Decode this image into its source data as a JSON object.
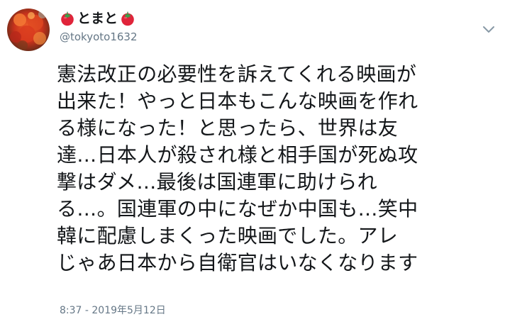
{
  "tweet": {
    "display_name": "とまと",
    "handle": "@tokyoto1632",
    "name_emoji_icon": "tomato-icon",
    "menu_icon": "chevron-down-icon",
    "text_lines": [
      "憲法改正の必要性を訴えてくれる映画が",
      "出来た！やっと日本もこんな映画を作れ",
      "る様になった！と思ったら、世界は友",
      "達…日本人が殺され様と相手国が死ぬ攻",
      "撃はダメ…最後は国連軍に助けられ",
      "る…。国連軍の中になぜか中国も…笑中",
      "韓に配慮しまくった映画でした。アレ",
      "じゃあ日本から自衛官はいなくなります"
    ],
    "timestamp": "8:37 - 2019年5月12日"
  },
  "colors": {
    "text": "#14171a",
    "secondary": "#657786",
    "tomato_red": "#e0243a",
    "tomato_leaf": "#3aa04a"
  }
}
